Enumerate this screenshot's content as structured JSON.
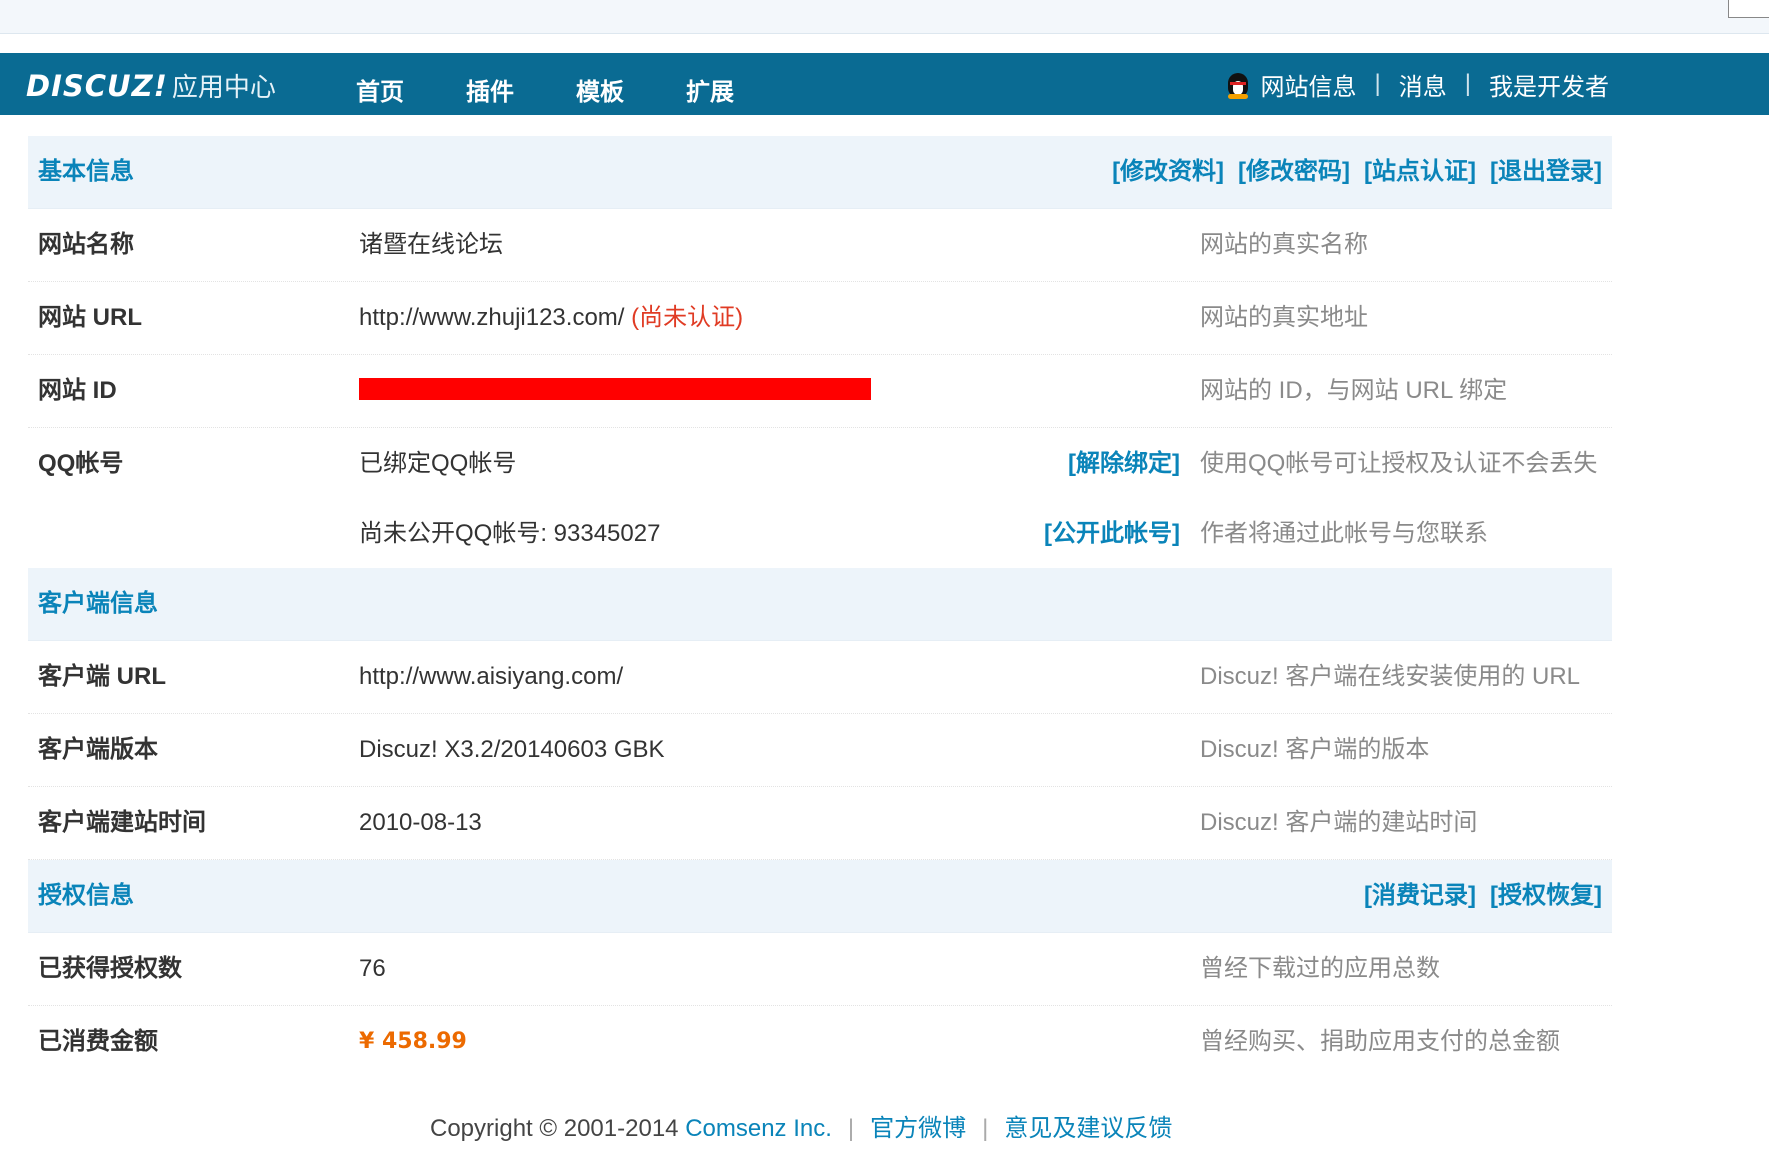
{
  "header": {
    "logo_brand": "DISCUZ!",
    "logo_sub": "应用中心",
    "nav": [
      "首页",
      "插件",
      "模板",
      "扩展"
    ],
    "user_links": [
      "网站信息",
      "消息",
      "我是开发者"
    ],
    "separator": "|"
  },
  "basic": {
    "title": "基本信息",
    "actions": [
      "[修改资料]",
      "[修改密码]",
      "[站点认证]",
      "[退出登录]"
    ],
    "rows": [
      {
        "label": "网站名称",
        "value": "诸暨在线论坛",
        "desc": "网站的真实名称"
      },
      {
        "label": "网站 URL",
        "value": "http://www.zhuji123.com/",
        "status": "(尚未认证)",
        "desc": "网站的真实地址"
      },
      {
        "label": "网站 ID",
        "value": "",
        "desc": "网站的 ID，与网站 URL 绑定"
      },
      {
        "label": "QQ帐号",
        "value": "已绑定QQ帐号",
        "action": "[解除绑定]",
        "desc": "使用QQ帐号可让授权及认证不会丢失"
      },
      {
        "label": "",
        "value": "尚未公开QQ帐号: 93345027",
        "action": "[公开此帐号]",
        "desc": "作者将通过此帐号与您联系"
      }
    ]
  },
  "client": {
    "title": "客户端信息",
    "rows": [
      {
        "label": "客户端 URL",
        "value": "http://www.aisiyang.com/",
        "desc": "Discuz! 客户端在线安装使用的 URL"
      },
      {
        "label": "客户端版本",
        "value": "Discuz! X3.2/20140603 GBK",
        "desc": "Discuz! 客户端的版本"
      },
      {
        "label": "客户端建站时间",
        "value": "2010-08-13",
        "desc": "Discuz! 客户端的建站时间"
      }
    ]
  },
  "license": {
    "title": "授权信息",
    "actions": [
      "[消费记录]",
      "[授权恢复]"
    ],
    "rows": [
      {
        "label": "已获得授权数",
        "value": "76",
        "desc": "曾经下载过的应用总数"
      },
      {
        "label": "已消费金额",
        "value": "¥ 458.99",
        "desc": "曾经购买、捐助应用支付的总金额"
      }
    ]
  },
  "footer": {
    "copyright": "Copyright © 2001-2014 ",
    "company": "Comsenz Inc.",
    "links": [
      "官方微博",
      "意见及建议反馈"
    ],
    "separator": "|"
  },
  "colors": {
    "nav_bg": "#0a6b93",
    "link": "#0a84b9",
    "warn": "#e03b24",
    "money": "#ec6a00",
    "redaction": "#ff0000"
  }
}
